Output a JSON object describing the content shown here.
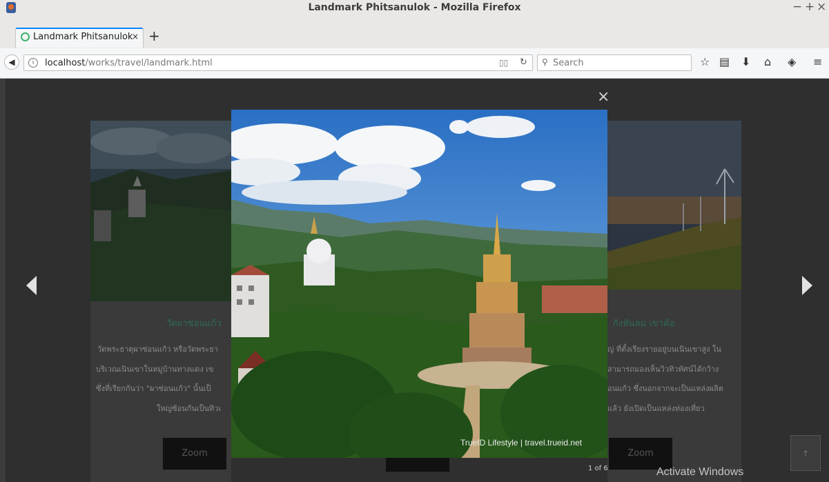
{
  "window": {
    "title": "Landmark Phitsanulok - Mozilla Firefox",
    "controls": [
      "−",
      "+",
      "×"
    ]
  },
  "tab": {
    "title": "Landmark Phitsanulok",
    "close": "×",
    "new_tab": "+"
  },
  "navbar": {
    "url_host": "localhost",
    "url_path": "/works/travel/landmark.html",
    "search_placeholder": "Search",
    "icons": [
      "back-icon",
      "info-icon",
      "reader-view-icon",
      "reload-icon",
      "search-icon",
      "bookmark-star-icon",
      "library-icon",
      "download-icon",
      "home-icon",
      "pocket-icon",
      "menu-icon"
    ]
  },
  "cards": [
    {
      "title": "วัดผาซ่อนแก้ว",
      "lines": [
        "วัดพระธาตุผาซ่อนแก้ว หรือวัดพระธา",
        "บริเวณเนินเขาในหมู่บ้านทางแดง เข",
        "ซึ่งที่เรียกกันว่า \"ผาซ่อนแก้ว\" นั้นเป็",
        "ใหญ่ซ้อนกันเป็นทิวเ"
      ],
      "zoom_label": "Zoom"
    },
    {
      "title": "กังหันลม เขาค้อ",
      "lines": [
        "ญ่ ที่ตั้งเรียงรายอยู่บนเนินเขาสูง ใน",
        "สามารถมองเห็นวิวทิวทัศน์ได้กว้าง",
        "อนแก้ว ซึ่งนอกจากจะเป็นแหล่งผลิต",
        "แล้ว ยังเปิดเป็นแหล่งท่องเที่ยว"
      ],
      "zoom_label": "Zoom"
    }
  ],
  "lightbox": {
    "close": "×",
    "watermark": "TrueID Lifestyle | travel.trueid.net",
    "counter": "1 of 6"
  },
  "scroll_top_label": "↑",
  "activate_windows": "Activate Windows",
  "colors": {
    "tab_accent": "#0a84ff",
    "card_title": "#2d6b52",
    "overlay": "#2f2f2f"
  }
}
